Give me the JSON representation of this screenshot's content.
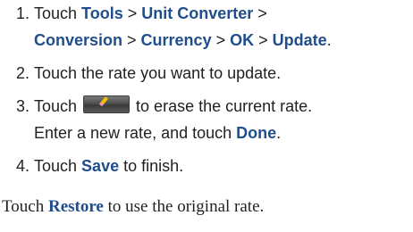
{
  "steps": [
    {
      "number": "1.",
      "parts": [
        "Touch ",
        "Tools",
        " > ",
        "Unit Converter",
        " >",
        "Conversion",
        " > ",
        "Currency",
        " > ",
        "OK",
        " > ",
        "Update",
        "."
      ]
    },
    {
      "number": "2.",
      "text": "Touch the rate you want to update."
    },
    {
      "number": "3.",
      "before": "Touch ",
      "icon": "erase-button-icon",
      "after": " to erase the current rate.",
      "line2": "Enter a new rate, and touch ",
      "done": "Done",
      "end": "."
    },
    {
      "number": "4.",
      "before": "Touch ",
      "save": "Save",
      "after": " to finish."
    }
  ],
  "note": {
    "before": "Touch ",
    "restore": "Restore",
    "after": " to use the original rate."
  },
  "colors": {
    "keyword": "#1f4e8c",
    "text": "#231f20"
  }
}
